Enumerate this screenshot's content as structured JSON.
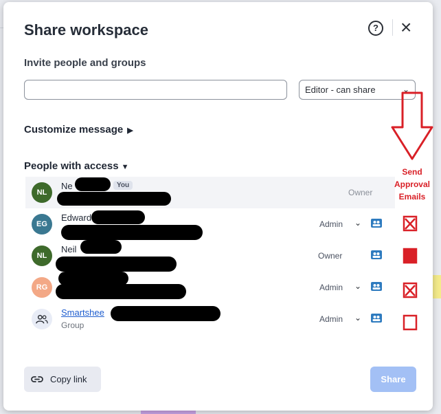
{
  "dialog": {
    "title": "Share workspace",
    "help_icon": "help-icon",
    "close_icon": "close-icon"
  },
  "invite": {
    "label": "Invite people and groups",
    "input_value": "",
    "input_placeholder": "",
    "permission_selected": "Editor - can share"
  },
  "customize": {
    "label": "Customize message"
  },
  "people": {
    "header": "People with access",
    "you_badge": "You",
    "items": [
      {
        "initials": "NL",
        "name": "Ne",
        "sub": "",
        "role": "Owner",
        "avatar_color": "#3e6a2b"
      },
      {
        "initials": "EG",
        "name": "Edward",
        "sub": "",
        "role": "Admin",
        "avatar_color": "#3a7891"
      },
      {
        "initials": "NL",
        "name": "Neil",
        "sub": "",
        "role": "Owner",
        "avatar_color": "#3e6a2b"
      },
      {
        "initials": "RG",
        "name": "",
        "sub": "",
        "role": "Admin",
        "avatar_color": "#f3a886"
      },
      {
        "initials": "",
        "name": "Smartshee",
        "sub": "Group",
        "role": "Admin",
        "avatar_color": "#e8ecf6"
      }
    ]
  },
  "annotation": {
    "text_lines": [
      "Send",
      "Approval",
      "Emails"
    ],
    "color": "#d92027"
  },
  "footer": {
    "copy_link": "Copy link",
    "share": "Share"
  },
  "colors": {
    "primary_disabled": "#a3c0f5",
    "group_icon": "#2e7bbf"
  }
}
